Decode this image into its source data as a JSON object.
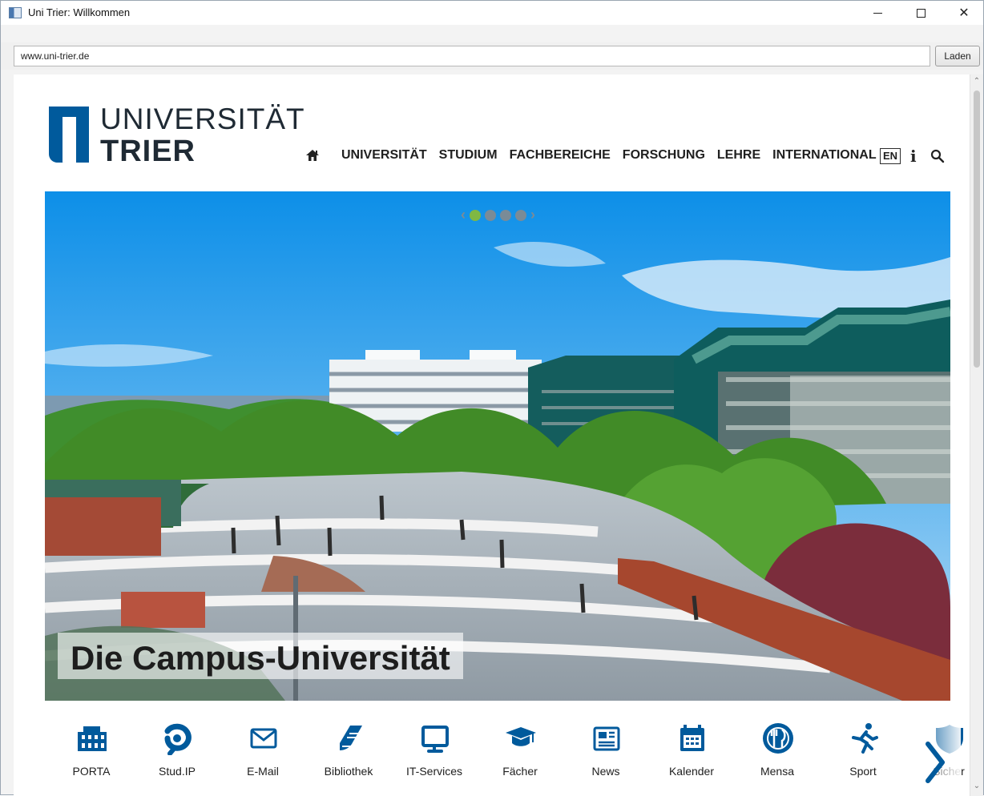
{
  "window": {
    "title": "Uni Trier: Willkommen"
  },
  "addressbar": {
    "url": "www.uni-trier.de",
    "load_label": "Laden"
  },
  "site": {
    "logo_top": "UNIVERSITÄT",
    "logo_bottom": "TRIER",
    "nav": [
      "UNIVERSITÄT",
      "STUDIUM",
      "FACHBEREICHE",
      "FORSCHUNG",
      "LEHRE",
      "INTERNATIONAL"
    ],
    "language": "EN",
    "hero_caption": "Die Campus-Universität",
    "quicklinks": [
      {
        "label": "PORTA",
        "icon": "building-icon"
      },
      {
        "label": "Stud.IP",
        "icon": "studip-icon"
      },
      {
        "label": "E-Mail",
        "icon": "mail-icon"
      },
      {
        "label": "Bibliothek",
        "icon": "book-icon"
      },
      {
        "label": "IT-Services",
        "icon": "monitor-icon"
      },
      {
        "label": "Fächer",
        "icon": "graduation-cap-icon"
      },
      {
        "label": "News",
        "icon": "newspaper-icon"
      },
      {
        "label": "Kalender",
        "icon": "calendar-icon"
      },
      {
        "label": "Mensa",
        "icon": "dining-icon"
      },
      {
        "label": "Sport",
        "icon": "running-icon"
      },
      {
        "label": "Sicher",
        "icon": "shield-icon"
      }
    ]
  },
  "colors": {
    "brand_blue": "#005a9c",
    "active_dot": "#80b843"
  }
}
